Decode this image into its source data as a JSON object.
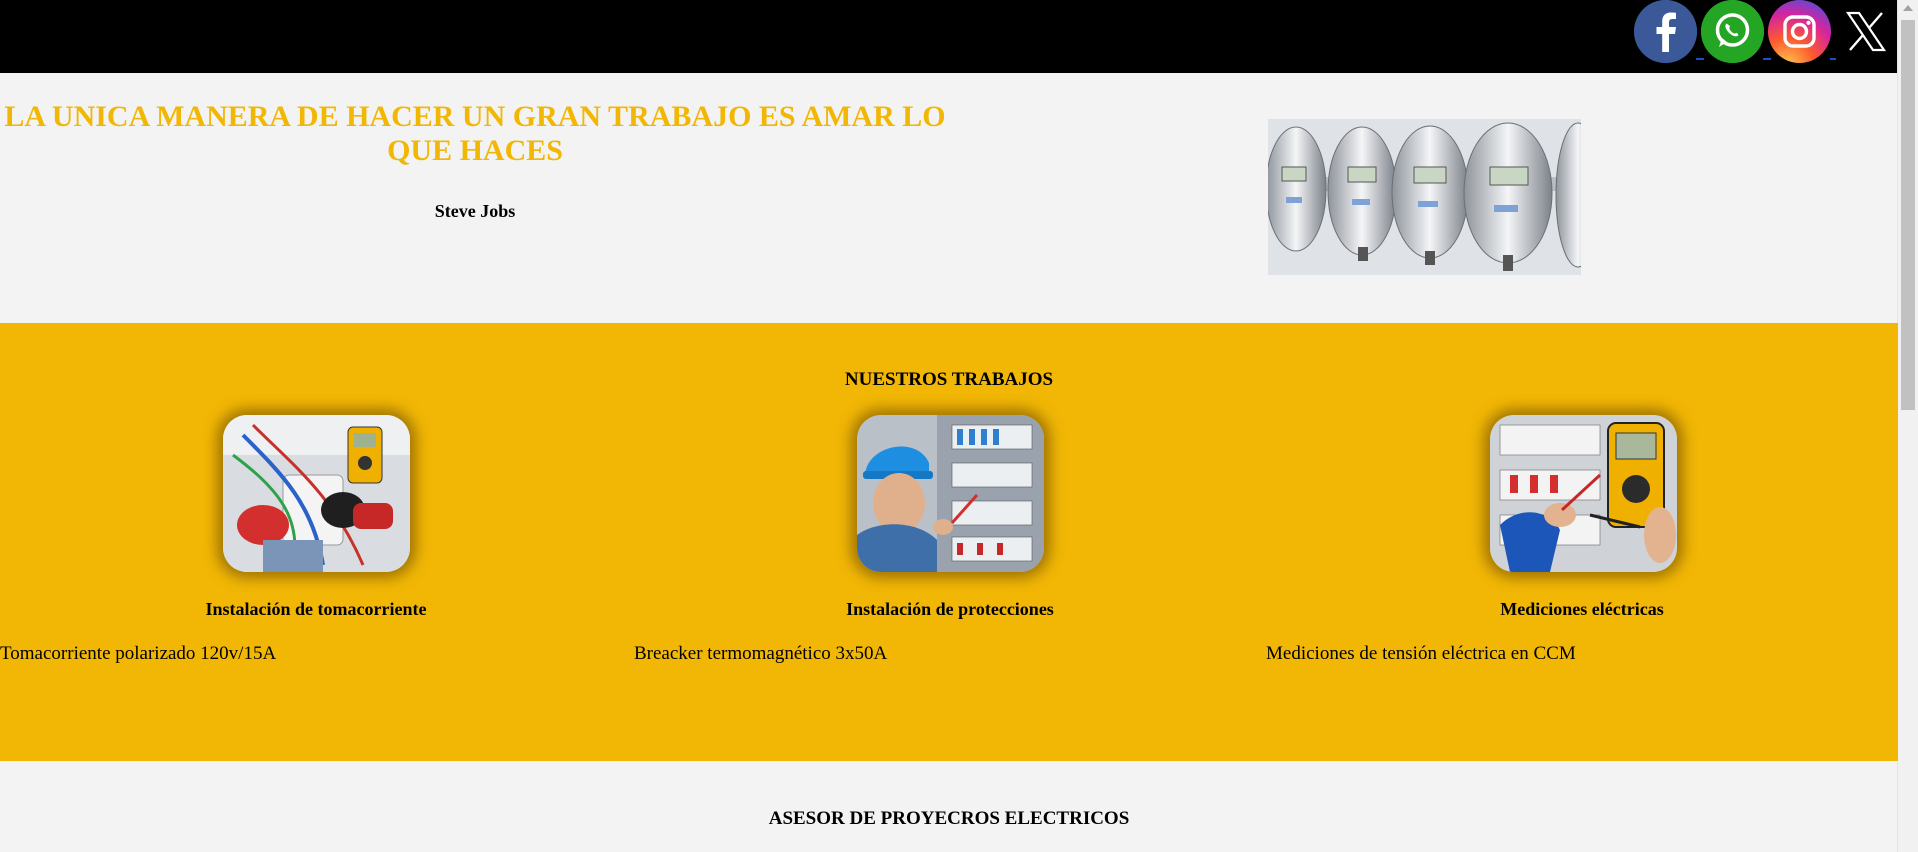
{
  "social": {
    "facebook": {
      "icon": "facebook-icon",
      "glyph": "f",
      "color": "#3b5998"
    },
    "whatsapp": {
      "icon": "whatsapp-icon",
      "color": "#25a524"
    },
    "instagram": {
      "icon": "instagram-icon"
    },
    "x": {
      "icon": "x-icon",
      "glyph": "𝕏"
    }
  },
  "hero": {
    "quote": "LA UNICA MANERA DE HACER UN GRAN TRABAJO ES AMAR LO QUE HACES",
    "author": "Steve Jobs",
    "accent_color": "#f2b705"
  },
  "works": {
    "title": "NUESTROS TRABAJOS",
    "background": "#f2b705",
    "items": [
      {
        "title": "Instalación de tomacorriente",
        "desc": "Tomacorriente polarizado 120v/15A"
      },
      {
        "title": "Instalación de protecciones",
        "desc": "Breacker termomagnético 3x50A"
      },
      {
        "title": "Mediciones eléctricas",
        "desc": "Mediciones de tensión eléctrica en CCM"
      }
    ]
  },
  "advisor": {
    "title": "ASESOR DE PROYECROS ELECTRICOS"
  }
}
